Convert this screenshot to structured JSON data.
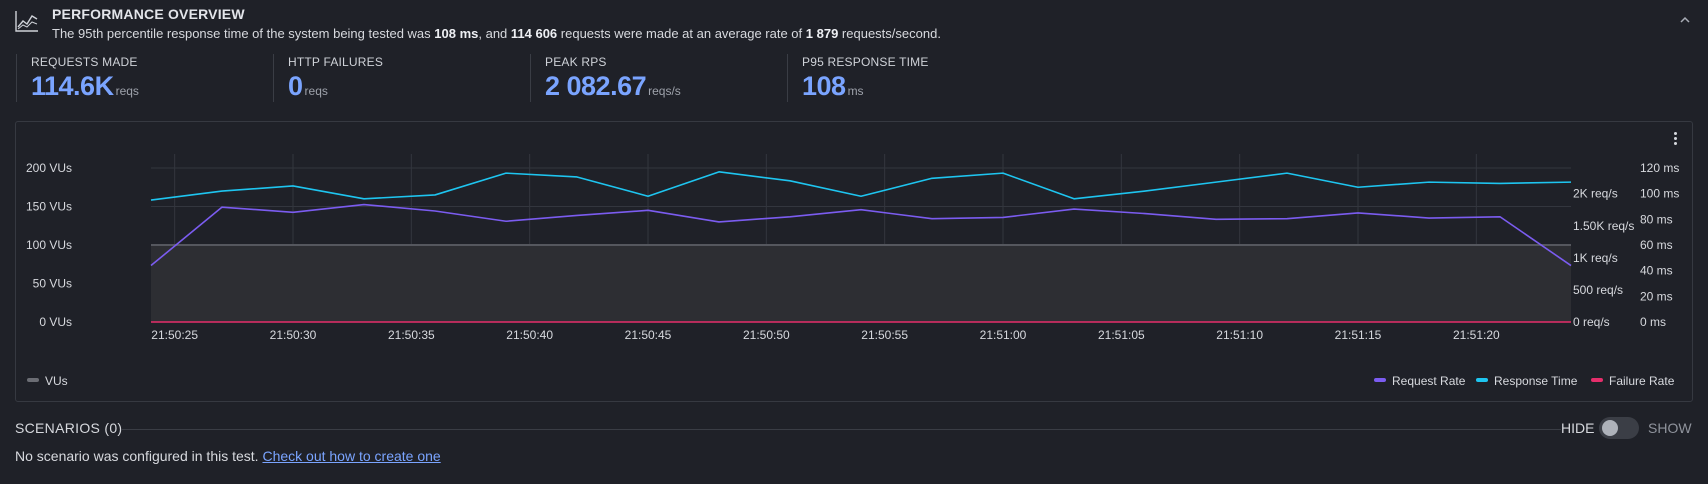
{
  "header": {
    "title": "PERFORMANCE OVERVIEW",
    "desc_1": "The 95th percentile response time of the system being tested was ",
    "desc_p95": "108 ms",
    "desc_2": ", and ",
    "desc_requests": "114 606",
    "desc_3": " requests were made at an average rate of ",
    "desc_rate": "1 879",
    "desc_4": " requests/second.",
    "collapse_icon": "chevron-up-icon",
    "icon": "line-chart-icon"
  },
  "stats": [
    {
      "label": "REQUESTS MADE",
      "value": "114.6K",
      "unit": "reqs"
    },
    {
      "label": "HTTP FAILURES",
      "value": "0",
      "unit": "reqs"
    },
    {
      "label": "PEAK RPS",
      "value": "2 082.67",
      "unit": "reqs/s"
    },
    {
      "label": "P95 RESPONSE TIME",
      "value": "108",
      "unit": "ms"
    }
  ],
  "chart_data": {
    "type": "line",
    "x": [
      "21:50:24",
      "21:50:27",
      "21:50:30",
      "21:50:33",
      "21:50:36",
      "21:50:39",
      "21:50:42",
      "21:50:45",
      "21:50:48",
      "21:50:51",
      "21:50:54",
      "21:50:57",
      "21:51:00",
      "21:51:03",
      "21:51:06",
      "21:51:09",
      "21:51:12",
      "21:51:15",
      "21:51:18",
      "21:51:21",
      "21:51:24"
    ],
    "x_ticks": [
      "21:50:25",
      "21:50:30",
      "21:50:35",
      "21:50:40",
      "21:50:45",
      "21:50:50",
      "21:50:55",
      "21:51:00",
      "21:51:05",
      "21:51:10",
      "21:51:15",
      "21:51:20"
    ],
    "axes": {
      "vus": {
        "ticks": [
          "0 VUs",
          "50 VUs",
          "100 VUs",
          "150 VUs",
          "200 VUs"
        ],
        "range": [
          0,
          200
        ]
      },
      "rps": {
        "ticks": [
          "0 req/s",
          "500 req/s",
          "1K req/s",
          "1.50K req/s",
          "2K req/s"
        ],
        "range": [
          0,
          2400
        ]
      },
      "ms": {
        "ticks": [
          "0 ms",
          "20 ms",
          "40 ms",
          "60 ms",
          "80 ms",
          "100 ms",
          "120 ms"
        ],
        "range": [
          0,
          120
        ]
      }
    },
    "series": [
      {
        "name": "VUs",
        "axis": "vus",
        "type": "area",
        "color": "#6b6d74",
        "values": [
          100,
          100,
          100,
          100,
          100,
          100,
          100,
          100,
          100,
          100,
          100,
          100,
          100,
          100,
          100,
          100,
          100,
          100,
          100,
          100,
          100
        ]
      },
      {
        "name": "Request Rate",
        "axis": "rps",
        "color": "#7b5cf0",
        "values": [
          880,
          1790,
          1710,
          1830,
          1730,
          1570,
          1660,
          1740,
          1560,
          1640,
          1750,
          1610,
          1630,
          1760,
          1690,
          1600,
          1610,
          1700,
          1620,
          1640,
          880
        ]
      },
      {
        "name": "Response Time",
        "axis": "ms",
        "color": "#1ec5f0",
        "values": [
          95,
          102,
          106,
          96,
          99,
          116,
          113,
          98,
          117,
          110,
          98,
          112,
          116,
          96,
          102,
          109,
          116,
          105,
          109,
          108,
          109
        ]
      },
      {
        "name": "Failure Rate",
        "axis": "rps",
        "color": "#e52e6b",
        "values": [
          0,
          0,
          0,
          0,
          0,
          0,
          0,
          0,
          0,
          0,
          0,
          0,
          0,
          0,
          0,
          0,
          0,
          0,
          0,
          0,
          0
        ]
      }
    ],
    "legend_left": [
      {
        "name": "VUs",
        "color": "#6b6d74"
      }
    ],
    "legend_right": [
      {
        "name": "Request Rate",
        "color": "#7b5cf0"
      },
      {
        "name": "Response Time",
        "color": "#1ec5f0"
      },
      {
        "name": "Failure Rate",
        "color": "#e52e6b"
      }
    ],
    "grid": true,
    "menu_icon": "kebab-menu-icon"
  },
  "scenarios": {
    "title": "SCENARIOS (0)",
    "hide_label": "HIDE",
    "show_label": "SHOW",
    "toggle_on": false,
    "empty_text": "No scenario was configured in this test. ",
    "link_text": "Check out how to create one"
  }
}
